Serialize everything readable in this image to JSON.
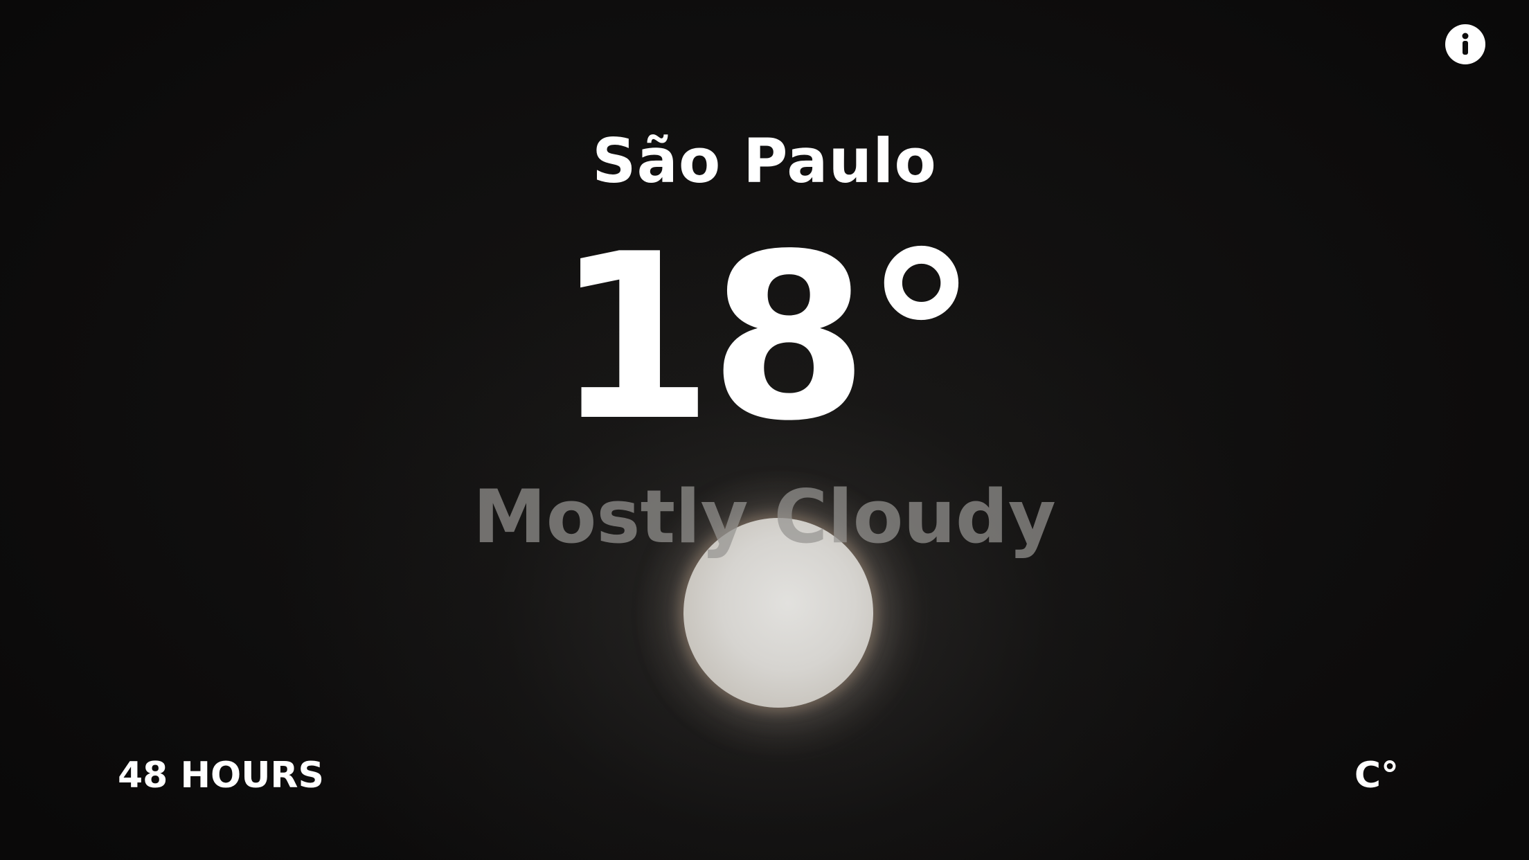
{
  "location": {
    "city": "São Paulo"
  },
  "current": {
    "temperature": "18°",
    "condition": "Mostly Cloudy"
  },
  "controls": {
    "forecast_toggle_label": "48 HOURS",
    "unit_toggle_label": "C°",
    "info_icon": "info-icon"
  },
  "background": {
    "scene": "moon-icon",
    "accent_color": "#ffffff"
  }
}
